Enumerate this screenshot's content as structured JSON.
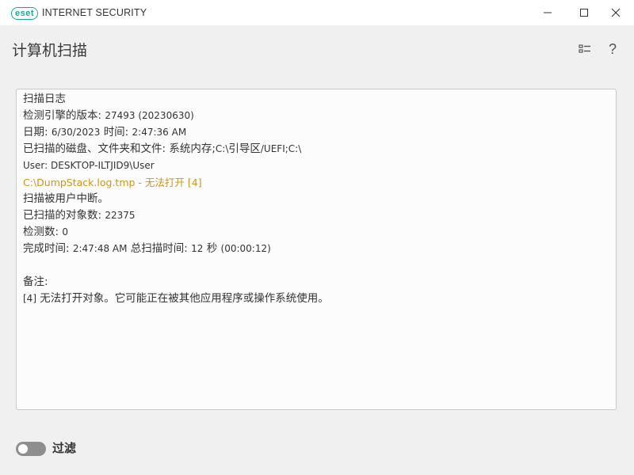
{
  "titlebar": {
    "logo": "eset",
    "product": "INTERNET SECURITY",
    "brand_color": "#1aa59a"
  },
  "header": {
    "title": "计算机扫描",
    "icons": [
      "list-view-icon",
      "help-icon"
    ],
    "help_glyph": "?"
  },
  "log": {
    "title": "扫描日志",
    "engine_label": "检测引擎的版本:",
    "engine_value": "27493 (20230630)",
    "date_label": "日期:",
    "date_value": "6/30/2023",
    "time_label": "时间:",
    "time_value": "2:47:36 AM",
    "scanned_label": "已扫描的磁盘、文件夹和文件:",
    "scanned_value_1": "系统内存;",
    "scanned_value_2": "C:\\",
    "scanned_value_3": "引导区",
    "scanned_value_4": "/UEFI;C:\\",
    "user_line": "User: DESKTOP-ILTJID9\\User",
    "warning_path": "C:\\DumpStack.log.tmp - ",
    "warning_text": "无法打开",
    "warning_code": "[4]",
    "warning_color": "#c8961e",
    "interrupted": "扫描被用户中断。",
    "objects_label": "已扫描的对象数:",
    "objects_value": "22375",
    "detections_label": "检测数:",
    "detections_value": "0",
    "finish_label": "完成时间:",
    "finish_value": "2:47:48 AM",
    "total_label": "总扫描时间:",
    "total_value": "12",
    "total_unit": "秒",
    "total_paren": "(00:00:12)",
    "notes_label": "备注:",
    "note_code": "[4]",
    "note_text": "无法打开对象。它可能正在被其他应用程序或操作系统使用。"
  },
  "footer": {
    "filter_label": "过滤",
    "filter_on": false
  }
}
